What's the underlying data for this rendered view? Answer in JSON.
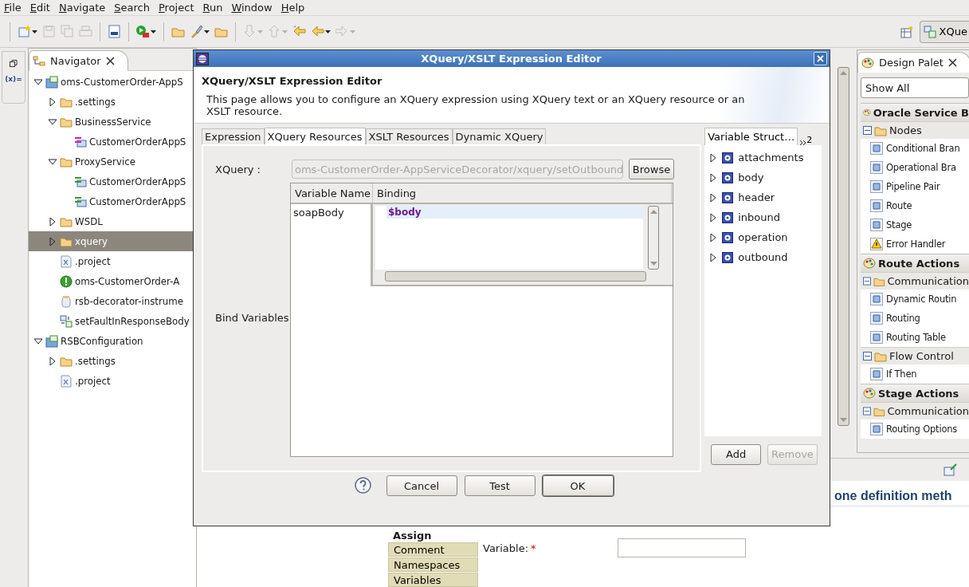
{
  "menu": [
    {
      "label": "File"
    },
    {
      "label": "Edit"
    },
    {
      "label": "Navigate"
    },
    {
      "label": "Search"
    },
    {
      "label": "Project"
    },
    {
      "label": "Run"
    },
    {
      "label": "Window"
    },
    {
      "label": "Help"
    }
  ],
  "toolbar": {
    "groups": [
      [
        {
          "kind": "new",
          "disabled": false,
          "dropdown": true
        },
        {
          "kind": "save",
          "disabled": true,
          "dropdown": false
        },
        {
          "kind": "save-all",
          "disabled": true,
          "dropdown": false
        },
        {
          "kind": "print",
          "disabled": true,
          "dropdown": false
        }
      ],
      [
        {
          "kind": "binary",
          "disabled": false,
          "dropdown": false
        }
      ],
      [
        {
          "kind": "run",
          "disabled": false,
          "dropdown": true
        }
      ],
      [
        {
          "kind": "folder",
          "disabled": false,
          "dropdown": false
        },
        {
          "kind": "brush",
          "disabled": false,
          "dropdown": true
        },
        {
          "kind": "folder",
          "disabled": false,
          "dropdown": false
        }
      ],
      [
        {
          "kind": "down",
          "disabled": true,
          "dropdown": true
        },
        {
          "kind": "up",
          "disabled": true,
          "dropdown": true
        },
        {
          "kind": "back-star",
          "disabled": false,
          "dropdown": false
        },
        {
          "kind": "back",
          "disabled": false,
          "dropdown": true
        },
        {
          "kind": "forward",
          "disabled": true,
          "dropdown": true
        }
      ]
    ],
    "perspective": "XQue"
  },
  "trim": {
    "variables_label": "(x)="
  },
  "navigator": {
    "title": "Navigator",
    "items": [
      {
        "label": "oms-CustomerOrder-AppS",
        "kind": "project",
        "expanded": true,
        "selected": false,
        "children": [
          {
            "label": ".settings",
            "kind": "folder",
            "expanded": false,
            "selected": false
          },
          {
            "label": "BusinessService",
            "kind": "folder",
            "expanded": true,
            "selected": false,
            "children": [
              {
                "label": "CustomerOrderAppS",
                "kind": "business",
                "selected": false
              }
            ]
          },
          {
            "label": "ProxyService",
            "kind": "folder",
            "expanded": true,
            "selected": false,
            "children": [
              {
                "label": "CustomerOrderAppS",
                "kind": "proxy",
                "selected": false
              },
              {
                "label": "CustomerOrderAppS",
                "kind": "proxy",
                "selected": false
              }
            ]
          },
          {
            "label": "WSDL",
            "kind": "folder",
            "expanded": false,
            "selected": false
          },
          {
            "label": "xquery",
            "kind": "folder",
            "expanded": false,
            "selected": true
          },
          {
            "label": ".project",
            "kind": "xml",
            "selected": false
          },
          {
            "label": "oms-CustomerOrder-A",
            "kind": "alert",
            "selected": false
          },
          {
            "label": "rsb-decorator-instrume",
            "kind": "jar",
            "selected": false
          },
          {
            "label": "setFaultInResponseBody",
            "kind": "xquery",
            "selected": false
          }
        ]
      },
      {
        "label": "RSBConfiguration",
        "kind": "project",
        "expanded": true,
        "selected": false,
        "children": [
          {
            "label": ".settings",
            "kind": "folder",
            "expanded": false,
            "selected": false
          },
          {
            "label": ".project",
            "kind": "xml",
            "selected": false
          }
        ]
      }
    ]
  },
  "palette": {
    "title": "Design Palet",
    "filter": "Show All",
    "categories": [
      {
        "name": "Oracle Service B",
        "groups": [
          {
            "name": "Nodes",
            "expanded": true,
            "items": [
              {
                "label": "Conditional Bran",
                "kind": "node"
              },
              {
                "label": "Operational Bra",
                "kind": "node"
              },
              {
                "label": "Pipeline Pair",
                "kind": "node"
              },
              {
                "label": "Route",
                "kind": "node"
              },
              {
                "label": "Stage",
                "kind": "node"
              },
              {
                "label": "Error Handler",
                "kind": "warning"
              }
            ]
          }
        ]
      },
      {
        "name": "Route Actions",
        "groups": [
          {
            "name": "Communication",
            "expanded": true,
            "items": [
              {
                "label": "Dynamic Routin",
                "kind": "node"
              },
              {
                "label": "Routing",
                "kind": "node"
              },
              {
                "label": "Routing Table",
                "kind": "node"
              }
            ]
          },
          {
            "name": "Flow Control",
            "expanded": true,
            "items": [
              {
                "label": "If Then",
                "kind": "node"
              }
            ]
          }
        ]
      },
      {
        "name": "Stage Actions",
        "groups": [
          {
            "name": "Communication",
            "expanded": true,
            "items": [
              {
                "label": "Routing Options",
                "kind": "node"
              }
            ]
          }
        ]
      }
    ]
  },
  "properties": {
    "heading": "one definition meth",
    "section": "Assign",
    "tabs": [
      {
        "label": "Comment",
        "selected": false
      },
      {
        "label": "Namespaces",
        "selected": false
      },
      {
        "label": "Variables",
        "selected": false
      }
    ],
    "field_label": "Variable:",
    "required": true,
    "required_mark": "*"
  },
  "dialog": {
    "window_title": "XQuery/XSLT Expression Editor",
    "heading": "XQuery/XSLT Expression Editor",
    "description": "This page allows you to configure an XQuery expression using XQuery text or an XQuery resource or an XSLT resource.",
    "tabs": [
      {
        "label": "Expression",
        "selected": false
      },
      {
        "label": "XQuery Resources",
        "selected": true
      },
      {
        "label": "XSLT Resources",
        "selected": false
      },
      {
        "label": "Dynamic XQuery",
        "selected": false
      }
    ],
    "xquery_label": "XQuery :",
    "xquery_field": {
      "value": "oms-CustomerOrder-AppServiceDecorator/xquery/setOutbound",
      "disabled": true
    },
    "browse": "Browse",
    "bind_label": "Bind Variables",
    "table": {
      "columns": [
        "Variable Name",
        "Binding"
      ],
      "rows": [
        {
          "variable": "soapBody",
          "binding": "$body"
        }
      ]
    },
    "variables": {
      "tabs": [
        {
          "label": "Variable Struct…",
          "selected": true
        }
      ],
      "overflow_count": "2",
      "items": [
        {
          "label": "attachments",
          "expanded": false
        },
        {
          "label": "body",
          "expanded": false
        },
        {
          "label": "header",
          "expanded": false
        },
        {
          "label": "inbound",
          "expanded": false
        },
        {
          "label": "operation",
          "expanded": false
        },
        {
          "label": "outbound",
          "expanded": false
        }
      ],
      "add": {
        "label": "Add",
        "disabled": false
      },
      "remove": {
        "label": "Remove",
        "disabled": true
      }
    },
    "buttons": [
      {
        "label": "Cancel",
        "default": false
      },
      {
        "label": "Test",
        "default": false
      },
      {
        "label": "OK",
        "default": true
      }
    ]
  }
}
